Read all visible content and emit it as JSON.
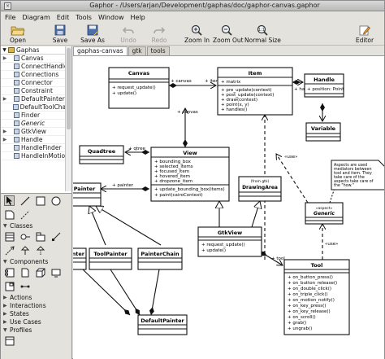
{
  "window": {
    "title": "Gaphor - /Users/arjan/Development/gaphas/doc/gaphor-canvas.gaphor"
  },
  "menu": [
    {
      "label": "File"
    },
    {
      "label": "Diagram"
    },
    {
      "label": "Edit"
    },
    {
      "label": "Tools"
    },
    {
      "label": "Window"
    },
    {
      "label": "Help"
    }
  ],
  "toolbar": {
    "open": "Open",
    "save": "Save",
    "save_as": "Save As",
    "undo": "Undo",
    "redo": "Redo",
    "zoom_in": "Zoom In",
    "zoom_out": "Zoom Out",
    "normal_size": "Normal Size",
    "editor": "Editor"
  },
  "tree": {
    "root": "Gaphas",
    "items": [
      {
        "label": "Canvas",
        "italic": false,
        "expandable": true
      },
      {
        "label": "ConnectHandle",
        "italic": false,
        "expandable": false
      },
      {
        "label": "Connections",
        "italic": false,
        "expandable": false
      },
      {
        "label": "Connector",
        "italic": false,
        "expandable": false
      },
      {
        "label": "Constraint",
        "italic": false,
        "expandable": false
      },
      {
        "label": "DefaultPainter",
        "italic": false,
        "expandable": true
      },
      {
        "label": "DefaultToolChain",
        "italic": false,
        "expandable": false
      },
      {
        "label": "Finder",
        "italic": false,
        "expandable": false
      },
      {
        "label": "Generic",
        "italic": true,
        "expandable": false
      },
      {
        "label": "GtkView",
        "italic": false,
        "expandable": true
      },
      {
        "label": "Handle",
        "italic": false,
        "expandable": true
      },
      {
        "label": "HandleFinder",
        "italic": false,
        "expandable": false
      },
      {
        "label": "HandleInMotion",
        "italic": false,
        "expandable": false
      }
    ]
  },
  "toolbox": {
    "sections": {
      "classes": "Classes",
      "components": "Components",
      "actions": "Actions",
      "interactions": "Interactions",
      "states": "States",
      "use_cases": "Use Cases",
      "profiles": "Profiles"
    }
  },
  "tabs": [
    {
      "label": "gaphas-canvas",
      "active": true
    },
    {
      "label": "gtk",
      "active": false
    },
    {
      "label": "tools",
      "active": false
    }
  ],
  "diagram": {
    "canvas": {
      "name": "Canvas",
      "ops": [
        "+ request_update()",
        "+ update()"
      ]
    },
    "item": {
      "name": "Item",
      "attrs": [
        "+ matrix"
      ],
      "ops": [
        "+ pre_update(context)",
        "+ post_update(context)",
        "+ draw(context)",
        "+ point(x, y)",
        "+ handles()"
      ]
    },
    "handle": {
      "name": "Handle",
      "attrs": [
        "+ position: Point"
      ]
    },
    "variable": {
      "name": "Variable"
    },
    "quadtree": {
      "name": "Quadtree"
    },
    "view": {
      "name": "View",
      "attrs": [
        "+ bounding_box",
        "+ selected_items",
        "+ focused_item",
        "+ hovered_item",
        "+ dropzone_item"
      ],
      "ops": [
        "+ update_bounding_box(items)",
        "+ paint(cairoContext)"
      ]
    },
    "painter": {
      "name": "Painter"
    },
    "drawingarea": {
      "stereo": "(from gtk)",
      "name": "DrawingArea"
    },
    "generic": {
      "stereo": "«aspect»",
      "name": "Generic"
    },
    "note": {
      "lines": [
        "Aspects are used",
        "mediators between",
        "tool and item. They",
        "take care of the",
        "aspects take care of",
        "the \"how.\""
      ]
    },
    "gtkview": {
      "name": "GtkView",
      "ops": [
        "+ request_update()",
        "+ update()"
      ]
    },
    "toolpainter": {
      "name": "ToolPainter"
    },
    "painterchain": {
      "name": "PainterChain"
    },
    "leftpainter": {
      "name": "Painter"
    },
    "defaultpainter": {
      "name": "DefaultPainter"
    },
    "tool": {
      "name": "Tool",
      "ops": [
        "+ on_button_press()",
        "+ on_button_release()",
        "+ on_double_click()",
        "+ on_triple_click()",
        "+ on_motion_notify()",
        "+ on_key_press()",
        "+ on_key_release()",
        "+ on_scroll()",
        "+ grab()",
        "+ ungrab()"
      ]
    },
    "labels": {
      "canvas_end": "+ canvas",
      "items_end": "+ items",
      "canvas_end2": "+ canvas",
      "handles_end": "+ handles",
      "qtree_end": "+ qtree",
      "painter_end": "+ painter",
      "tool_end": "+ tool",
      "use1": "«use»",
      "use2": "«use»"
    }
  }
}
